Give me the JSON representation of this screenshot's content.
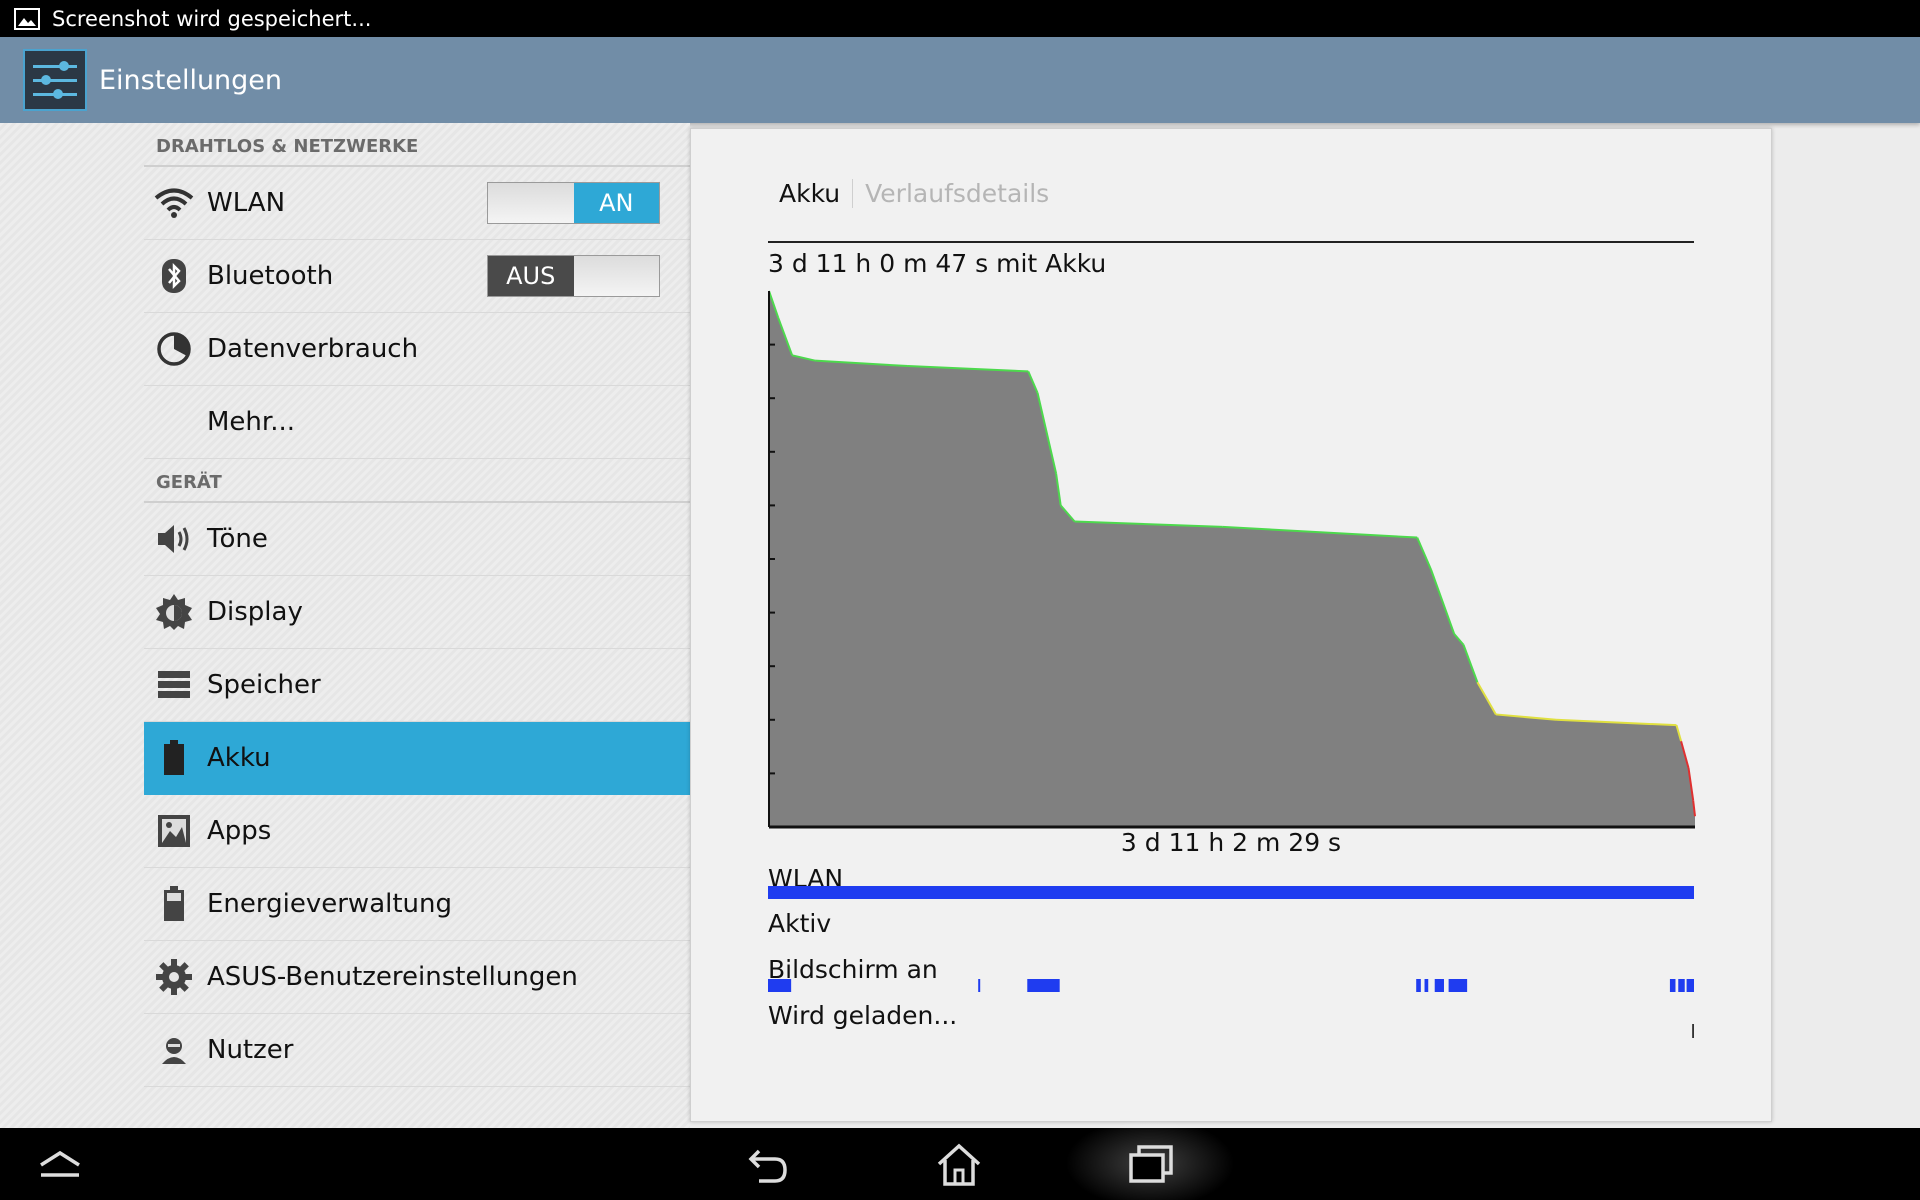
{
  "status_bar": {
    "notification": "Screenshot wird gespeichert..."
  },
  "action_bar": {
    "title": "Einstellungen"
  },
  "settings_list": {
    "sections": [
      {
        "header": "DRAHTLOS & NETZWERKE"
      },
      {
        "header": "GERÄT"
      }
    ],
    "items": [
      {
        "label": "WLAN",
        "icon": "wifi-icon",
        "toggle": "AN"
      },
      {
        "label": "Bluetooth",
        "icon": "bluetooth-icon",
        "toggle": "AUS"
      },
      {
        "label": "Datenverbrauch",
        "icon": "data-usage-icon"
      },
      {
        "label": "Mehr..."
      },
      {
        "label": "Töne",
        "icon": "speaker-icon"
      },
      {
        "label": "Display",
        "icon": "brightness-icon"
      },
      {
        "label": "Speicher",
        "icon": "storage-icon"
      },
      {
        "label": "Akku",
        "icon": "battery-icon",
        "selected": true
      },
      {
        "label": "Apps",
        "icon": "apps-icon"
      },
      {
        "label": "Energieverwaltung",
        "icon": "power-battery-icon"
      },
      {
        "label": "ASUS-Benutzereinstellungen",
        "icon": "gear-icon"
      },
      {
        "label": "Nutzer",
        "icon": "user-icon"
      }
    ]
  },
  "battery_panel": {
    "tabs": [
      "Akku",
      "Verlaufsdetails"
    ],
    "duration_label": "3 d 11 h 0 m 47 s mit Akku",
    "time_label": "3 d 11 h 2 m 29 s",
    "rows": [
      "WLAN",
      "Aktiv",
      "Bildschirm an",
      "Wird geladen..."
    ]
  },
  "colors": {
    "accent": "#2ea8d6",
    "action_bar": "#718da7",
    "graph_fill": "#808080",
    "graph_good": "#4dd94d",
    "graph_mid": "#e0e040",
    "graph_low": "#e03030",
    "activity_bar": "#1f3cf0"
  },
  "navigation": {
    "buttons": [
      "menu-icon",
      "back-icon",
      "home-icon",
      "recent-apps-icon"
    ]
  },
  "chart_data": {
    "type": "area",
    "title": "3 d 11 h 0 m 47 s mit Akku",
    "xlabel": "3 d 11 h 2 m 29 s",
    "ylabel": "",
    "xlim": [
      0,
      100
    ],
    "ylim": [
      0,
      100
    ],
    "x": [
      0,
      1,
      2.5,
      5,
      15,
      28,
      29,
      31,
      31.5,
      33,
      49,
      70,
      70.5,
      71.5,
      74,
      75,
      76.5,
      77.5,
      78.5,
      85,
      98,
      98.5,
      99.3,
      99.8,
      100
    ],
    "values": [
      100,
      95,
      88,
      87,
      86,
      85,
      81,
      66,
      60,
      57,
      56,
      54,
      52,
      48,
      36,
      34,
      27,
      24,
      21,
      20,
      19,
      16,
      11,
      5,
      2
    ],
    "level_colors": {
      "high": "#4dd94d",
      "mid": "#e0e040",
      "low": "#e03030"
    },
    "activity_rows": {
      "WLAN": [
        [
          0,
          100
        ]
      ],
      "Aktiv": [],
      "Bildschirm an": [
        [
          0,
          2.5
        ],
        [
          22.7,
          22.9
        ],
        [
          28,
          31.5
        ],
        [
          70,
          70.5
        ],
        [
          70.9,
          71.3
        ],
        [
          72,
          73
        ],
        [
          73.5,
          75.5
        ],
        [
          97.4,
          98
        ],
        [
          98.3,
          99
        ],
        [
          99.2,
          100
        ]
      ],
      "Wird geladen...": [
        [
          99.8,
          100
        ]
      ]
    }
  }
}
